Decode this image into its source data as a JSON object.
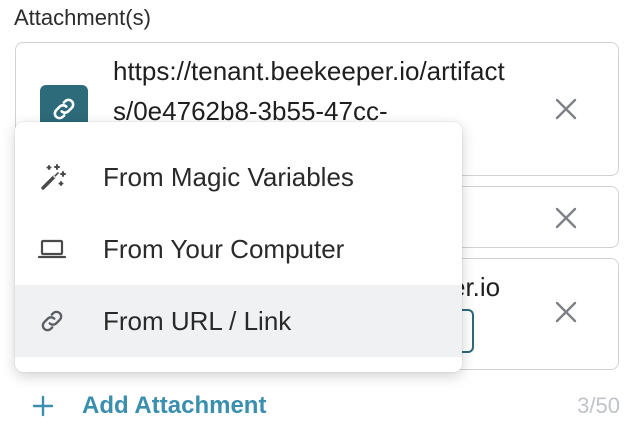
{
  "section": {
    "label": "Attachment(s)"
  },
  "attachments": [
    {
      "url": "https://tenant.beekeeper.io/artifacts/0e4762b8-3b55-47cc-",
      "icon": "link-icon",
      "remove_icon": "close-icon"
    },
    {
      "remove_icon": "close-icon"
    },
    {
      "url_partial": "er.io",
      "remove_icon": "close-icon"
    }
  ],
  "menu": {
    "items": [
      {
        "label": "From Magic Variables",
        "icon": "magic-wand-icon"
      },
      {
        "label": "From Your Computer",
        "icon": "laptop-icon"
      },
      {
        "label": "From URL / Link",
        "icon": "link-icon",
        "active": true
      }
    ]
  },
  "footer": {
    "add_label": "Add Attachment",
    "add_icon": "plus-icon",
    "counter": "3/50"
  },
  "colors": {
    "accent": "#3a8fae",
    "thumb": "#2d6a7a",
    "border": "#cfd3d6",
    "active_row": "#eff1f3",
    "counter": "#c0c4c8"
  }
}
